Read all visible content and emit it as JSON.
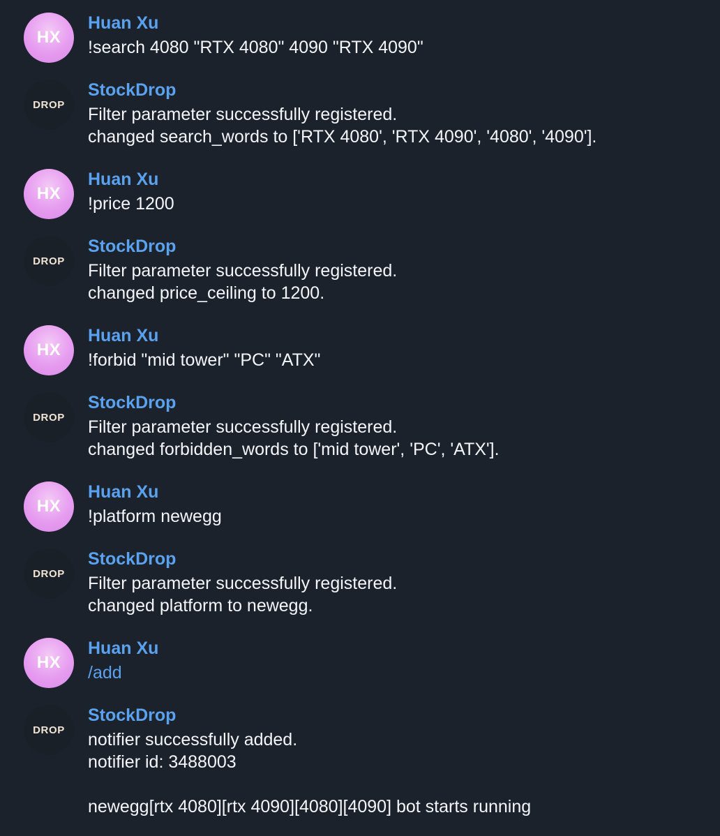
{
  "messages": [
    {
      "sender": "Huan Xu",
      "avatar": "HX",
      "lines": [
        "!search 4080 \"RTX 4080\" 4090 \"RTX 4090\""
      ]
    },
    {
      "sender": "StockDrop",
      "avatar": "DROP",
      "lines": [
        "Filter parameter successfully registered.",
        "changed search_words to ['RTX 4080', 'RTX 4090', '4080', '4090']."
      ]
    },
    {
      "sender": "Huan Xu",
      "avatar": "HX",
      "lines": [
        "!price 1200"
      ]
    },
    {
      "sender": "StockDrop",
      "avatar": "DROP",
      "lines": [
        "Filter parameter successfully registered.",
        "changed price_ceiling to 1200."
      ]
    },
    {
      "sender": "Huan Xu",
      "avatar": "HX",
      "lines": [
        "!forbid \"mid tower\" \"PC\" \"ATX\""
      ]
    },
    {
      "sender": "StockDrop",
      "avatar": "DROP",
      "lines": [
        "Filter parameter successfully registered.",
        "changed forbidden_words to ['mid tower', 'PC', 'ATX']."
      ]
    },
    {
      "sender": "Huan Xu",
      "avatar": "HX",
      "lines": [
        "!platform newegg"
      ]
    },
    {
      "sender": "StockDrop",
      "avatar": "DROP",
      "lines": [
        "Filter parameter successfully registered.",
        "changed platform to newegg."
      ]
    },
    {
      "sender": "Huan Xu",
      "avatar": "HX",
      "lines": [
        "/add"
      ]
    },
    {
      "sender": "StockDrop",
      "avatar": "DROP",
      "lines": [
        "notifier successfully added.",
        "notifier id: 3488003",
        "",
        "newegg[rtx 4080][rtx 4090][4080][4090] bot starts running"
      ]
    }
  ],
  "colors": {
    "background": "#1c222c",
    "sender_name": "#5aa2ee",
    "message_text": "#f3f5f8",
    "command_link": "#5aa2ee",
    "hx_avatar": "#e69cf0",
    "drop_avatar": "#1a2028"
  }
}
